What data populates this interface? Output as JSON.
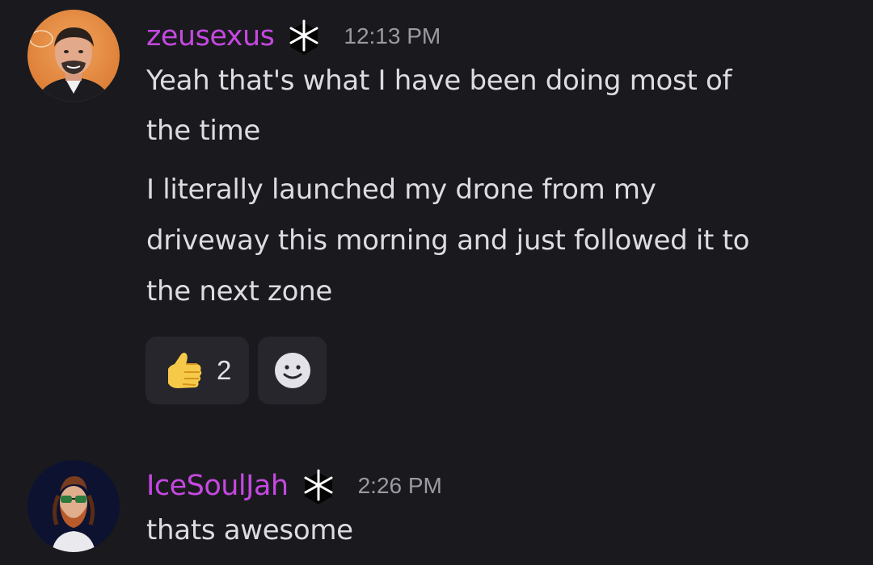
{
  "messages": [
    {
      "username": "zeusexus",
      "timestamp": "12:13 PM",
      "avatar_watermark": "food",
      "paragraphs": [
        [
          "Yeah that's what I have been doing most of",
          "the time"
        ],
        [
          "I literally launched my drone from my",
          "driveway this morning and just followed it to",
          "the next zone"
        ]
      ],
      "reactions": [
        {
          "emoji": "thumbs-up-icon",
          "count": "2"
        }
      ]
    },
    {
      "username": "IceSoulJah",
      "timestamp": "2:26 PM",
      "paragraphs": [
        [
          "thats awesome"
        ]
      ]
    }
  ],
  "colors": {
    "background": "#1a1a1e",
    "username": "#c548e0",
    "message_text": "#dcdce1",
    "timestamp": "#9a9aa3",
    "reaction_bg": "#26262c"
  }
}
